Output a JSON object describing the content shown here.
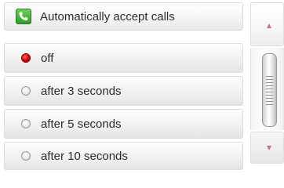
{
  "header": {
    "icon": "phone-icon",
    "label": "Automatically accept calls"
  },
  "options": [
    {
      "label": "off",
      "selected": true
    },
    {
      "label": "after 3 seconds",
      "selected": false
    },
    {
      "label": "after 5 seconds",
      "selected": false
    },
    {
      "label": "after 10 seconds",
      "selected": false
    }
  ],
  "scrollbar": {
    "up_icon": "arrow-up-icon",
    "down_icon": "arrow-down-icon",
    "thumb_icon": "grip-icon"
  },
  "colors": {
    "selected_radio": "#d40000",
    "icon_green": "#2e9a2a",
    "arrow": "#d07070"
  }
}
